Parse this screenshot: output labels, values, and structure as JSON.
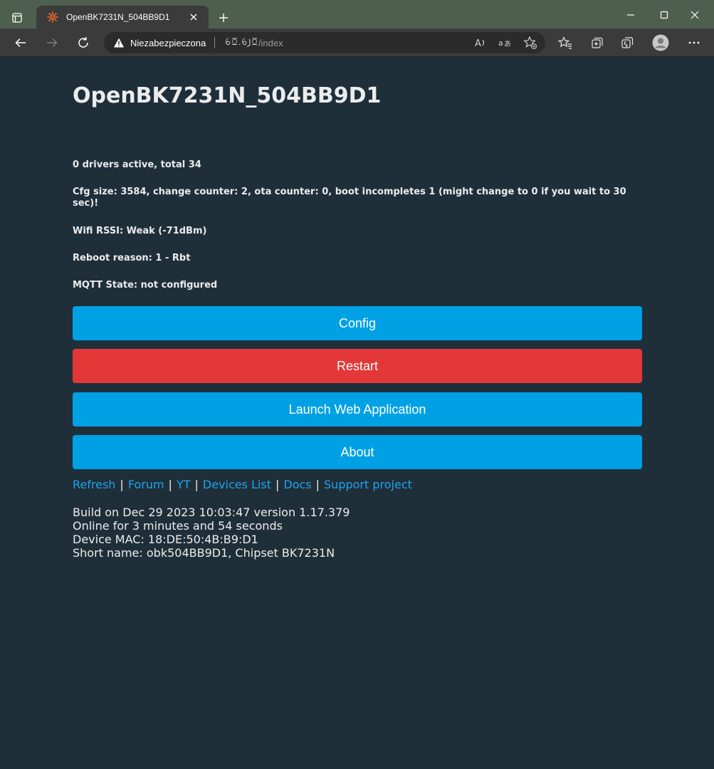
{
  "browser": {
    "tab_title": "OpenBK7231N_504BB9D1",
    "security_label": "Niezabezpieczona",
    "url_host": "ꕃꗞ.ꕃ꠸ꗞ",
    "url_path": "/index"
  },
  "page": {
    "title": "OpenBK7231N_504BB9D1",
    "status": {
      "drivers": "0 drivers active, total 34",
      "cfg": "Cfg size: 3584, change counter: 2, ota counter: 0, boot incompletes 1 (might change to 0 if you wait to 30 sec)!",
      "wifi": "Wifi RSSI: Weak (-71dBm)",
      "reboot": "Reboot reason: 1 - Rbt",
      "mqtt": "MQTT State: not configured"
    },
    "buttons": {
      "config": "Config",
      "restart": "Restart",
      "launch": "Launch Web Application",
      "about": "About"
    },
    "links": {
      "refresh": "Refresh",
      "forum": "Forum",
      "yt": "YT",
      "devices": "Devices List",
      "docs": "Docs",
      "support": "Support project",
      "separator": "|"
    },
    "info": {
      "build": "Build on Dec 29 2023 10:03:47 version 1.17.379",
      "online": "Online for 3 minutes and 54 seconds",
      "mac": "Device MAC: 18:DE:50:4B:B9:D1",
      "short": "Short name: obk504BB9D1, Chipset BK7231N"
    }
  },
  "colors": {
    "page_bg": "#1f2f3a",
    "button_blue": "#00a1e4",
    "button_red": "#e43838",
    "link": "#1fa3ec"
  }
}
